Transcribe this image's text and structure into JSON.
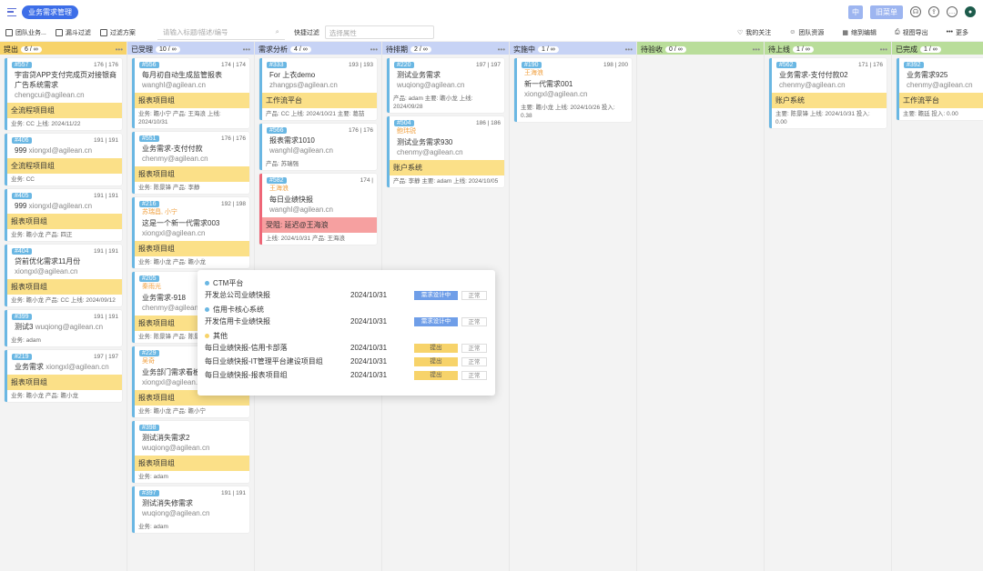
{
  "topbar": {
    "title": "业务需求管理",
    "btn1": "中",
    "btn2": "旧菜单"
  },
  "toolbar": {
    "team": "团队业务...",
    "funnel": "漏斗过滤",
    "plan": "过滤方案",
    "search_placeholder": "请输入标题/描述/编号",
    "quick_label": "快捷过滤",
    "quick_placeholder": "选择属性",
    "r1": "我的关注",
    "r2": "团队资源",
    "r3": "缩到编辑",
    "r4": "视图导出",
    "r5": "更多"
  },
  "columns": [
    {
      "name": "提出",
      "count": "6 / ∞",
      "color": "#f7d36a"
    },
    {
      "name": "已受理",
      "count": "10 / ∞",
      "color": "#c7d3f5"
    },
    {
      "name": "需求分析",
      "count": "4 / ∞",
      "color": "#c7d3f5"
    },
    {
      "name": "待排期",
      "count": "2 / ∞",
      "color": "#c7d3f5"
    },
    {
      "name": "实施中",
      "count": "1 / ∞",
      "color": "#c7d3f5"
    },
    {
      "name": "待验收",
      "count": "0 / ∞",
      "color": "#b9dd9a"
    },
    {
      "name": "待上线",
      "count": "1 / ∞",
      "color": "#b9dd9a"
    },
    {
      "name": "已完成",
      "count": "1 / ∞",
      "color": "#b9dd9a"
    }
  ],
  "c0": [
    {
      "id": "#557",
      "num": "176 | 176",
      "title": "宇宙贷APP支付完成页对接银商广告系统需求",
      "user": "chengcui@agilean.cn",
      "group": "全流程项目组",
      "meta": "业务: CC 上线: 2024/11/22"
    },
    {
      "id": "#406",
      "num": "191 | 191",
      "title": "999",
      "user": "xiongxl@agilean.cn",
      "group": "全流程项目组",
      "meta": "业务: CC"
    },
    {
      "id": "#405",
      "num": "191 | 191",
      "title": "999",
      "user": "xiongxl@agilean.cn",
      "group": "报表项目组",
      "meta": "业务: 瞻小龙 产品: 四正"
    },
    {
      "id": "#404",
      "num": "191 | 191",
      "title": "贷前优化需求11月份",
      "user": "xiongxl@agilean.cn",
      "group": "报表项目组",
      "meta": "业务: 瞻小龙 产品: CC 上线: 2024/09/12"
    },
    {
      "id": "#399",
      "num": "191 | 191",
      "title": "测试3",
      "user": "wuqiong@agilean.cn",
      "group": "",
      "meta": "业务: adam"
    },
    {
      "id": "#219",
      "num": "197 | 197",
      "title": "业务需求",
      "user": "xiongxl@agilean.cn",
      "group": "报表项目组",
      "meta": "业务: 瞻小龙 产品: 瞻小龙"
    }
  ],
  "c1": [
    {
      "id": "#556",
      "num": "174 | 174",
      "title": "每月初自动生成监管报表",
      "user": "wanghl@agilean.cn",
      "group": "报表项目组",
      "meta": "业务: 瞻小宁 产品: 王海浪 上线: 2024/10/31"
    },
    {
      "id": "#551",
      "num": "176 | 176",
      "title": "业务需求-支付付款",
      "user": "chenmy@agilean.cn",
      "group": "报表项目组",
      "meta": "业务: 陈景锋 产品: 李静"
    },
    {
      "id": "#216",
      "num": "192 | 198",
      "title": "这是一个新一代需求003",
      "user": "xiongxl@agilean.cn",
      "group": "报表项目组",
      "meta": "业务: 瞻小龙 产品: 瞻小龙",
      "who": "苏瑞昌, 小宁"
    },
    {
      "id": "#205",
      "num": "",
      "title": "业务需求-918",
      "user": "chenmy@agilean.cn",
      "group": "报表项目组",
      "meta": "业务: 陈景锋 产品: 陈景锋",
      "who": "秦雨光"
    },
    {
      "id": "#229",
      "num": "",
      "title": "业务部门需求看板示例",
      "user": "xiongxl@agilean.cn",
      "group": "报表项目组",
      "meta": "业务: 瞻小龙 产品: 瞻小宁",
      "who": "吴奇"
    },
    {
      "id": "#398",
      "num": "",
      "title": "测试消失需求2",
      "user": "wuqiong@agilean.cn",
      "group": "报表项目组",
      "meta": "业务: adam"
    },
    {
      "id": "#397",
      "num": "191 | 191",
      "title": "测试消失修需求",
      "user": "wuqiong@agilean.cn",
      "group": "",
      "meta": "业务: adam"
    }
  ],
  "c2": [
    {
      "id": "#333",
      "num": "193 | 193",
      "title": "For 上衣demo",
      "user": "zhangps@agilean.cn",
      "group": "工作流平台",
      "meta": "产品: CC 上线: 2024/10/21 主要: 葛喆"
    },
    {
      "id": "#566",
      "num": "176 | 176",
      "title": "报表需求1010",
      "user": "wanghl@agilean.cn",
      "group": "",
      "meta": "产品: 苏瑞强"
    },
    {
      "id": "#582",
      "num": "174 |",
      "title": "每日业绩快报",
      "user": "wanghl@agilean.cn",
      "group": "受阻: 延迟@王海浪",
      "meta": "上线: 2024/10/31 产品: 王海浪",
      "who": "王海浪"
    }
  ],
  "c3": [
    {
      "id": "#220",
      "num": "197 | 197",
      "title": "测试业务需求",
      "user": "wuqiong@agilean.cn",
      "group": "",
      "meta": "产品: adam 主要: 瞻小龙 上线: 2024/09/28"
    },
    {
      "id": "#504",
      "num": "186 | 186",
      "title": "测试业务需求930",
      "user": "chenmy@agilean.cn",
      "group": "账户系统",
      "meta": "产品: 李静 主要: adam 上线: 2024/10/05",
      "who": "鲍玮锐"
    }
  ],
  "c4": [
    {
      "id": "#190",
      "num": "198 | 200",
      "title": "新一代需求001",
      "user": "xiongxl@agilean.cn",
      "group": "",
      "meta": "主要: 瞻小龙 上线: 2024/10/26 投入: 0.38",
      "who": "王海浪"
    }
  ],
  "c6": [
    {
      "id": "#562",
      "num": "171 | 176",
      "title": "业务需求-支付付款02",
      "user": "chenmy@agilean.cn",
      "group": "账户系统",
      "meta": "主要: 陈景锋 上线: 2024/10/31 投入: 0.00"
    }
  ],
  "c7": [
    {
      "id": "#392",
      "num": "176 | 176",
      "title": "业务需求925",
      "user": "chenmy@agilean.cn",
      "group": "工作流平台",
      "meta": "主要: 瞻廷 投入: 0.00"
    }
  ],
  "popup": {
    "s1": "CTM平台",
    "r1": {
      "t": "开发总公司业绩快报",
      "d": "2024/10/31",
      "st": "需求设计中",
      "ok": "正常"
    },
    "s2": "信用卡核心系统",
    "r2": {
      "t": "开发信用卡业绩快报",
      "d": "2024/10/31",
      "st": "需求设计中",
      "ok": "正常"
    },
    "s3": "其他",
    "r3": {
      "t": "每日业绩快报-信用卡部落",
      "d": "2024/10/31",
      "st": "提出",
      "ok": "正常"
    },
    "r4": {
      "t": "每日业绩快报-IT管理平台建设项目组",
      "d": "2024/10/31",
      "st": "提出",
      "ok": "正常"
    },
    "r5": {
      "t": "每日业绩快报-报表项目组",
      "d": "2024/10/31",
      "st": "提出",
      "ok": "正常"
    }
  }
}
